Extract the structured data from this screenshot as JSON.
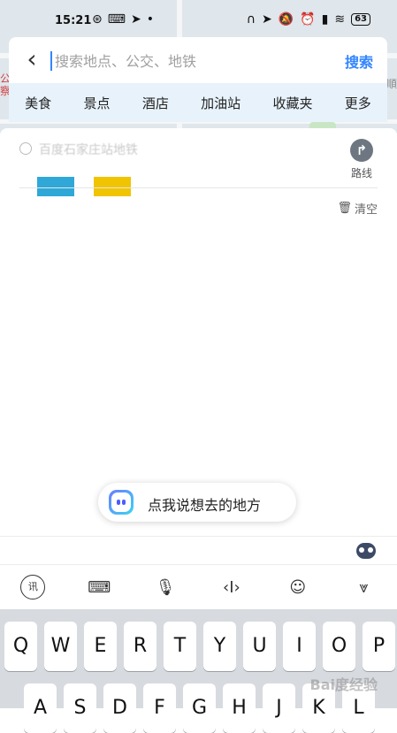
{
  "status_bar": {
    "time": "15:21",
    "battery": "63"
  },
  "map": {
    "labels": [
      "公",
      "察",
      "順"
    ]
  },
  "search": {
    "back_label": "‹",
    "placeholder": "搜索地点、公交、地铁",
    "value": "",
    "search_button_label": "搜索"
  },
  "categories": [
    {
      "label": "美食"
    },
    {
      "label": "景点"
    },
    {
      "label": "酒店"
    },
    {
      "label": "加油站"
    },
    {
      "label": "收藏夹"
    },
    {
      "label": "更多"
    }
  ],
  "history": {
    "item_text": "百度石家庄站地铁",
    "swatch_colors": [
      "#2fa8d8",
      "#f0c400"
    ],
    "route_label": "路线",
    "clear_label": "清空"
  },
  "voice": {
    "label": "点我说想去的地方"
  },
  "keyboard": {
    "toolbar_icons": [
      "ime-switch-icon",
      "keyboard-icon",
      "microphone-icon",
      "cursor-move-icon",
      "emoji-icon",
      "hide-keyboard-icon"
    ],
    "rows": [
      [
        "Q",
        "W",
        "E",
        "R",
        "T",
        "Y",
        "U",
        "I",
        "O",
        "P"
      ],
      [
        "A",
        "S",
        "D",
        "F",
        "G",
        "H",
        "J",
        "K",
        "L"
      ]
    ]
  },
  "watermark": "Bai度经验"
}
